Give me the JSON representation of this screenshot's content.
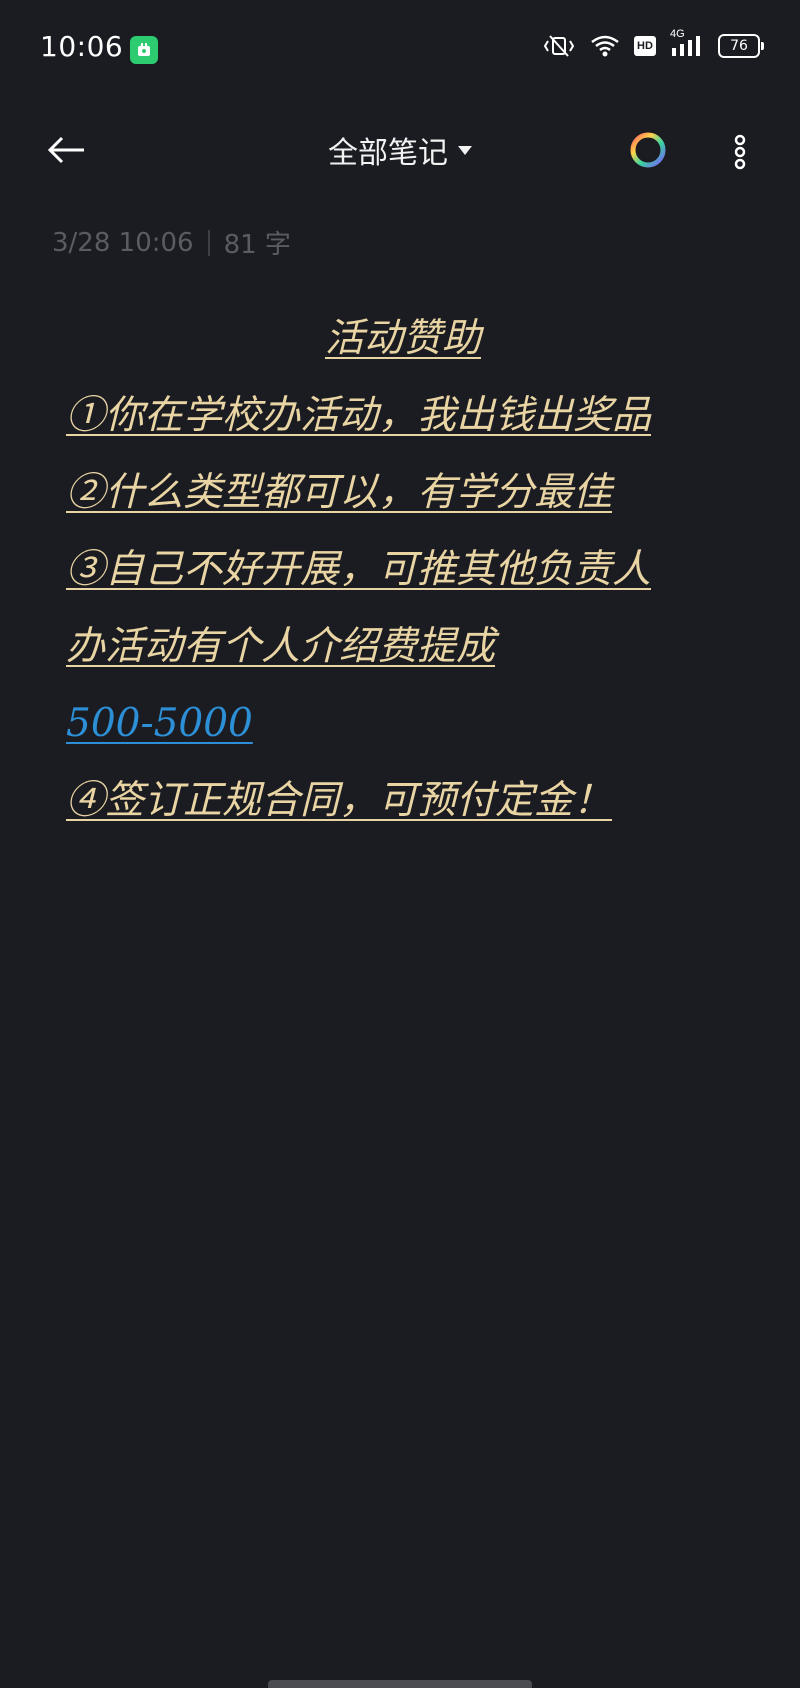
{
  "status_bar": {
    "time": "10:06",
    "battery": "76",
    "network": "4G",
    "hd": "HD",
    "icons": [
      "app-notification-icon",
      "vibrate-icon",
      "wifi-icon",
      "hd-icon",
      "signal-4g-icon",
      "battery-icon"
    ]
  },
  "app_bar": {
    "title": "全部笔记",
    "icons": [
      "back-arrow-icon",
      "dropdown-caret-icon",
      "color-palette-icon",
      "more-vertical-icon"
    ]
  },
  "meta": {
    "datetime": "3/28 10:06",
    "word_count": "81 字"
  },
  "note": {
    "title": "活动赞助",
    "lines": [
      "①你在学校办活动，我出钱出奖品",
      "②什么类型都可以，有学分最佳",
      "③自己不好开展，可推其他负责人",
      "办活动有个人介绍费提成",
      "500-5000",
      "④签订正规合同，可预付定金！"
    ]
  },
  "colors": {
    "background": "#1b1c21",
    "note_text": "#e9d4a3",
    "link_text": "#2d8fd6",
    "meta_text": "#5a5c62"
  }
}
